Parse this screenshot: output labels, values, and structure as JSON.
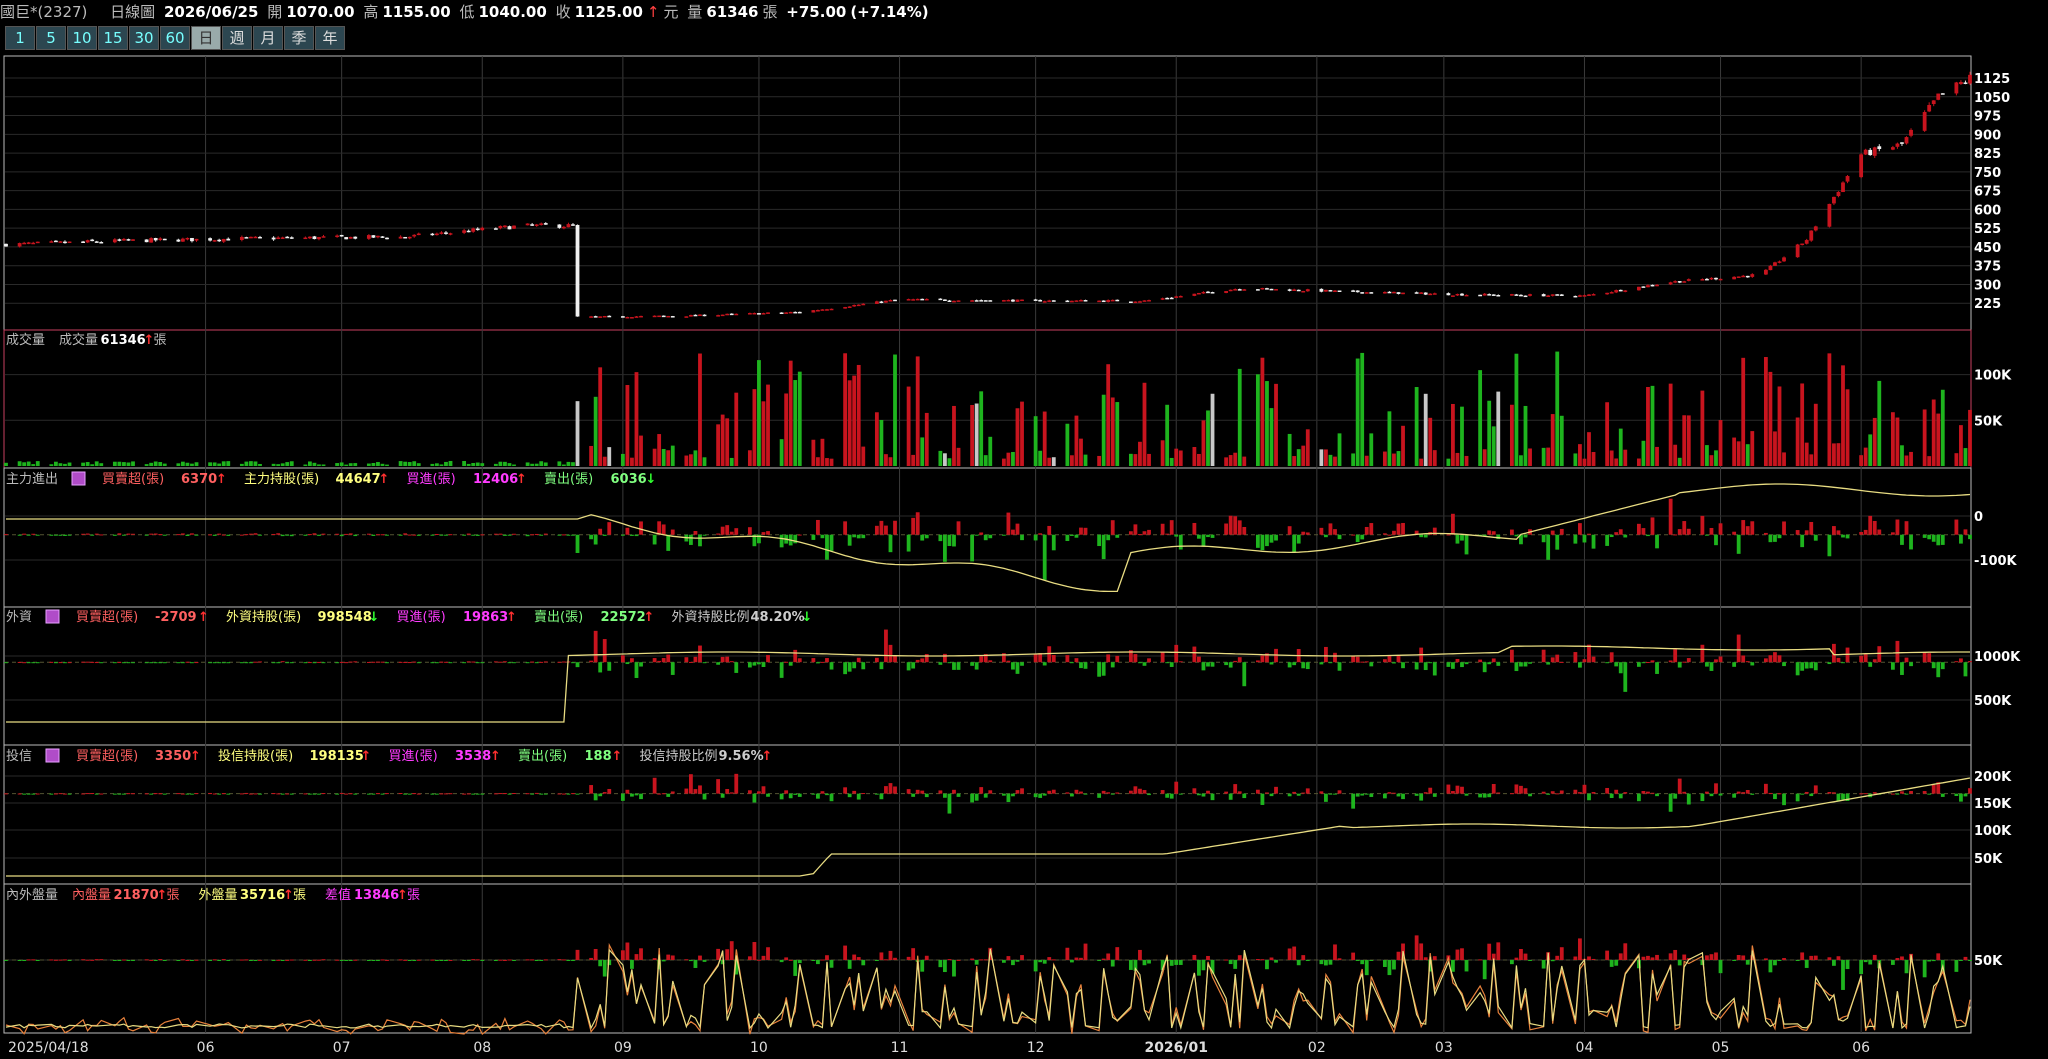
{
  "header": {
    "stock": "國巨*(2327)",
    "chart_kind": "日線圖",
    "date": "2026/06/25",
    "open_label": "開",
    "open": "1070.00",
    "high_label": "高",
    "high": "1155.00",
    "low_label": "低",
    "low": "1040.00",
    "close_label": "收",
    "close": "1125.00",
    "close_unit": "元",
    "vol_label": "量",
    "vol": "61346",
    "vol_unit": "張",
    "change": "+75.00",
    "change_pct": "(+7.14%)"
  },
  "period_buttons": [
    "1",
    "5",
    "10",
    "15",
    "30",
    "60",
    "日",
    "週",
    "月",
    "季",
    "年"
  ],
  "colors": {
    "up": "#c8141e",
    "down": "#1eb41e",
    "neutral": "#c8c8c8",
    "line": "#e8dc82",
    "line2": "#e8823c",
    "grid": "#3a3a3a",
    "frame": "#bbbbbb",
    "magenta": "#ff3cff",
    "accent_red": "#ff5050"
  },
  "chart_data": [
    {
      "type": "candlestick",
      "panel": "price",
      "x_start": "2025/04/18",
      "x_end": "2026/06/25",
      "month_ticks": [
        "2025/04/18",
        "06",
        "07",
        "08",
        "09",
        "10",
        "11",
        "12",
        "2026/01",
        "02",
        "03",
        "04",
        "05",
        "06"
      ],
      "y_ticks": [
        225,
        300,
        375,
        450,
        525,
        600,
        675,
        750,
        825,
        900,
        975,
        1050,
        1125
      ],
      "ylim": [
        150,
        1165
      ],
      "approx_closes": [
        {
          "date": "2025/04/18",
          "close": 460
        },
        {
          "date": "2025/05/15",
          "close": 475
        },
        {
          "date": "2025/06/15",
          "close": 485
        },
        {
          "date": "2025/07/15",
          "close": 490
        },
        {
          "date": "2025/08/10",
          "close": 535
        },
        {
          "date": "2025/08/20",
          "close": 535
        },
        {
          "date": "2025/08/22",
          "close": 170
        },
        {
          "date": "2025/09/15",
          "close": 175
        },
        {
          "date": "2025/10/10",
          "close": 190
        },
        {
          "date": "2025/11/01",
          "close": 240
        },
        {
          "date": "2025/12/01",
          "close": 235
        },
        {
          "date": "2025/12/25",
          "close": 235
        },
        {
          "date": "2026/01/15",
          "close": 285
        },
        {
          "date": "2026/02/10",
          "close": 270
        },
        {
          "date": "2026/03/05",
          "close": 260
        },
        {
          "date": "2026/04/01",
          "close": 255
        },
        {
          "date": "2026/04/20",
          "close": 310
        },
        {
          "date": "2026/05/10",
          "close": 340
        },
        {
          "date": "2026/05/20",
          "close": 480
        },
        {
          "date": "2026/06/01",
          "close": 820
        },
        {
          "date": "2026/06/10",
          "close": 860
        },
        {
          "date": "2026/06/18",
          "close": 1050
        },
        {
          "date": "2026/06/25",
          "close": 1125
        }
      ]
    },
    {
      "type": "bar",
      "panel": "volume",
      "title": "成交量",
      "legend": [
        {
          "label": "成交量",
          "value": "61346",
          "arrow": "↑",
          "unit": "張"
        }
      ],
      "y_ticks": [
        "50K",
        "100K"
      ],
      "ylim": [
        0,
        140000
      ]
    },
    {
      "type": "bar+line",
      "panel": "main_force",
      "title": "主力進出",
      "legend": [
        {
          "label": "買賣超(張)",
          "value": "6370",
          "arrow": "↑"
        },
        {
          "label": "主力持股(張)",
          "value": "44647",
          "arrow": "↑"
        },
        {
          "label": "買進(張)",
          "value": "12406",
          "arrow": "↑"
        },
        {
          "label": "賣出(張)",
          "value": "6036",
          "arrow": "↓"
        }
      ],
      "y_ticks": [
        "0",
        "-100K"
      ]
    },
    {
      "type": "bar+line",
      "panel": "foreign",
      "title": "外資",
      "legend": [
        {
          "label": "買賣超(張)",
          "value": "-2709",
          "arrow": "↑"
        },
        {
          "label": "外資持股(張)",
          "value": "998548",
          "arrow": "↓"
        },
        {
          "label": "買進(張)",
          "value": "19863",
          "arrow": "↑"
        },
        {
          "label": "賣出(張)",
          "value": "22572",
          "arrow": "↑"
        },
        {
          "label": "外資持股比例",
          "value": "48.20%",
          "arrow": "↓"
        }
      ],
      "y_ticks": [
        "500K",
        "1000K"
      ]
    },
    {
      "type": "bar+line",
      "panel": "trust",
      "title": "投信",
      "legend": [
        {
          "label": "買賣超(張)",
          "value": "3350",
          "arrow": "↑"
        },
        {
          "label": "投信持股(張)",
          "value": "198135",
          "arrow": "↑"
        },
        {
          "label": "買進(張)",
          "value": "3538",
          "arrow": "↑"
        },
        {
          "label": "賣出(張)",
          "value": "188",
          "arrow": "↑"
        },
        {
          "label": "投信持股比例",
          "value": "9.56%",
          "arrow": "↑"
        }
      ],
      "y_ticks": [
        "50K",
        "100K",
        "150K",
        "200K"
      ]
    },
    {
      "type": "bar+line",
      "panel": "inner_outer",
      "title": "內外盤量",
      "legend": [
        {
          "label": "內盤量",
          "value": "21870",
          "arrow": "↑",
          "unit": "張"
        },
        {
          "label": "外盤量",
          "value": "35716",
          "arrow": "↑",
          "unit": "張"
        },
        {
          "label": "差值",
          "value": "13846",
          "arrow": "↑",
          "unit": "張"
        }
      ],
      "y_ticks": [
        "50K"
      ]
    }
  ]
}
